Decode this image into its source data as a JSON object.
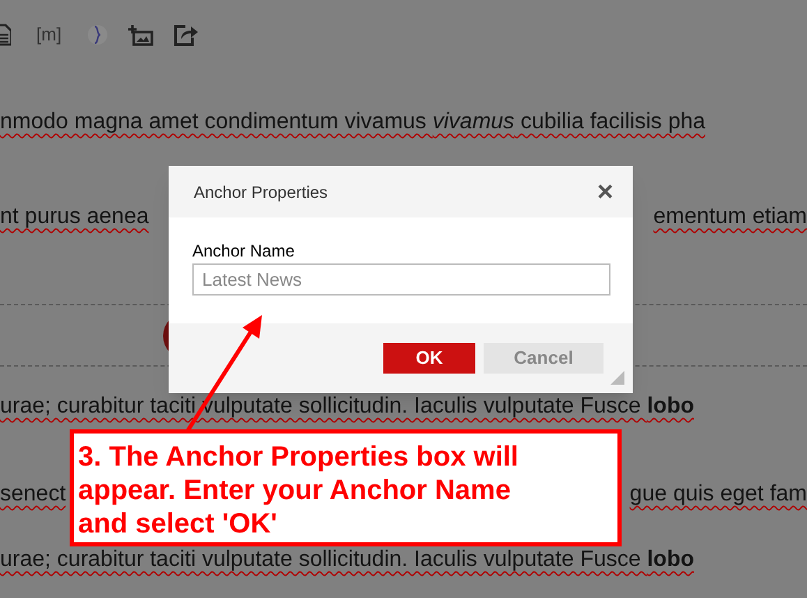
{
  "toolbar": {
    "items": [
      {
        "kind": "doc"
      },
      {
        "kind": "text",
        "label": "[m]"
      },
      {
        "kind": "brace"
      },
      {
        "kind": "image-add"
      },
      {
        "kind": "share"
      }
    ]
  },
  "text_lines": [
    {
      "segments": [
        "nmodo magna amet condimentum vivamus *vivamus* cubilia facilisis pha"
      ]
    },
    {
      "segments": [
        "nt purus aenea",
        "ementum etiam"
      ]
    },
    {
      "segments": [
        "urae; curabitur taciti vulputate sollicitudin. Iaculis vulputate Fusce **lobo**"
      ]
    },
    {
      "segments": [
        "senect",
        "gue quis eget fam"
      ]
    },
    {
      "segments": [
        "urae; curabitur taciti vulputate sollicitudin. Iaculis vulputate Fusce **lobo**"
      ]
    }
  ],
  "dialog": {
    "title": "Anchor Properties",
    "close": "×",
    "field_label": "Anchor Name",
    "placeholder": "Latest News",
    "buttons": [
      {
        "label": "OK",
        "kind": "primary"
      },
      {
        "label": "Cancel",
        "kind": "secondary"
      }
    ]
  },
  "callout": {
    "text": "3. The Anchor Properties box will appear. Enter your Anchor Name and select 'OK'"
  }
}
